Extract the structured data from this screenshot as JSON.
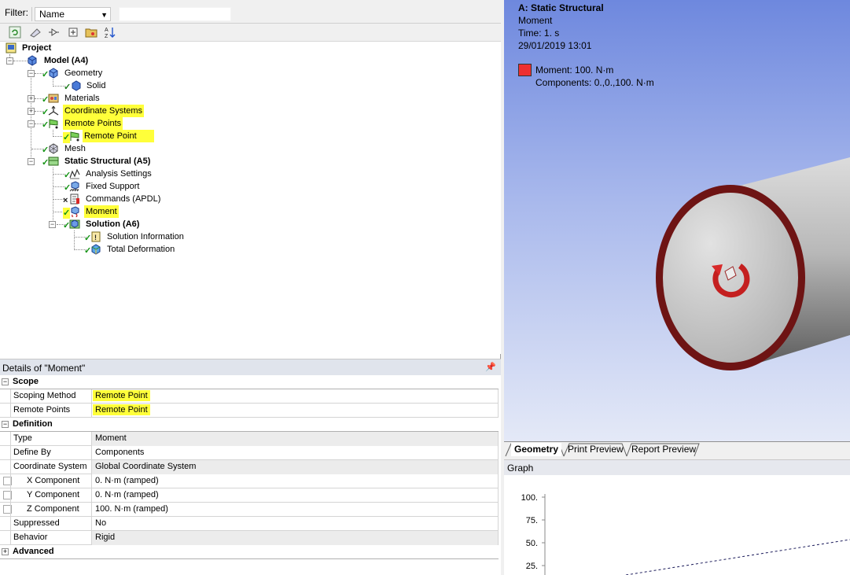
{
  "filter": {
    "label": "Filter:",
    "selected": "Name",
    "text": ""
  },
  "tree": {
    "project": "Project",
    "model": "Model (A4)",
    "geometry": "Geometry",
    "solid": "Solid",
    "materials": "Materials",
    "coordinate_systems": "Coordinate Systems",
    "remote_points": "Remote Points",
    "remote_point": "Remote Point",
    "mesh": "Mesh",
    "static_structural": "Static Structural (A5)",
    "analysis_settings": "Analysis Settings",
    "fixed_support": "Fixed Support",
    "commands": "Commands (APDL)",
    "moment": "Moment",
    "solution": "Solution (A6)",
    "solution_information": "Solution Information",
    "total_deformation": "Total Deformation"
  },
  "details": {
    "title": "Details of \"Moment\"",
    "categories": {
      "scope": "Scope",
      "definition": "Definition",
      "advanced": "Advanced"
    },
    "rows": [
      {
        "key": "Scoping Method",
        "value": "Remote Point"
      },
      {
        "key": "Remote Points",
        "value": "Remote Point"
      },
      {
        "key": "Type",
        "value": "Moment"
      },
      {
        "key": "Define By",
        "value": "Components"
      },
      {
        "key": "Coordinate System",
        "value": "Global Coordinate System"
      },
      {
        "key": "X Component",
        "value": "0. N·m  (ramped)"
      },
      {
        "key": "Y Component",
        "value": "0. N·m  (ramped)"
      },
      {
        "key": "Z Component",
        "value": "100. N·m  (ramped)"
      },
      {
        "key": "Suppressed",
        "value": "No"
      },
      {
        "key": "Behavior",
        "value": "Rigid"
      }
    ]
  },
  "viewport": {
    "title": "A: Static Structural",
    "object": "Moment",
    "time": "Time: 1. s",
    "date": "29/01/2019 13:01",
    "legend_label": "Moment: 100. N·m",
    "legend_components": "Components: 0.,0.,100. N·m",
    "legend_color": "#ee3030"
  },
  "tabs": [
    "Geometry",
    "Print Preview",
    "Report Preview"
  ],
  "graph": {
    "title": "Graph",
    "y_ticks": [
      "100.",
      "75.",
      "50.",
      "25."
    ]
  },
  "colors": {
    "highlight": "#ffff3a",
    "check": "#139213",
    "accent": "#6e88de"
  }
}
